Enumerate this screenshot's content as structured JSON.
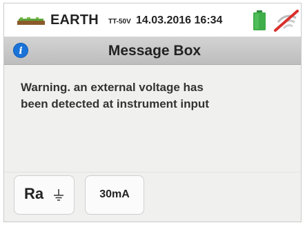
{
  "status_bar": {
    "mode": "EARTH",
    "mode_sub": "TT-50V",
    "datetime": "14.03.2016 16:34",
    "earth_icon": "earth-ground-icon",
    "battery_icon": "battery-icon",
    "signal_icon": "wireless-disabled-icon"
  },
  "dialog": {
    "title": "Message Box",
    "icon": "info-icon",
    "message_line1": "Warning. an external voltage has",
    "message_line2": "been detected at instrument input"
  },
  "softkeys": {
    "ra_label": "Ra",
    "ra_icon": "ground-symbol-icon",
    "current_label": "30mA"
  },
  "colors": {
    "info_blue": "#1a73d9",
    "battery_green": "#3fae49",
    "cross_red": "#d9302c",
    "titlebar_gray": "#c8c8c8",
    "background": "#f0f0ee"
  }
}
